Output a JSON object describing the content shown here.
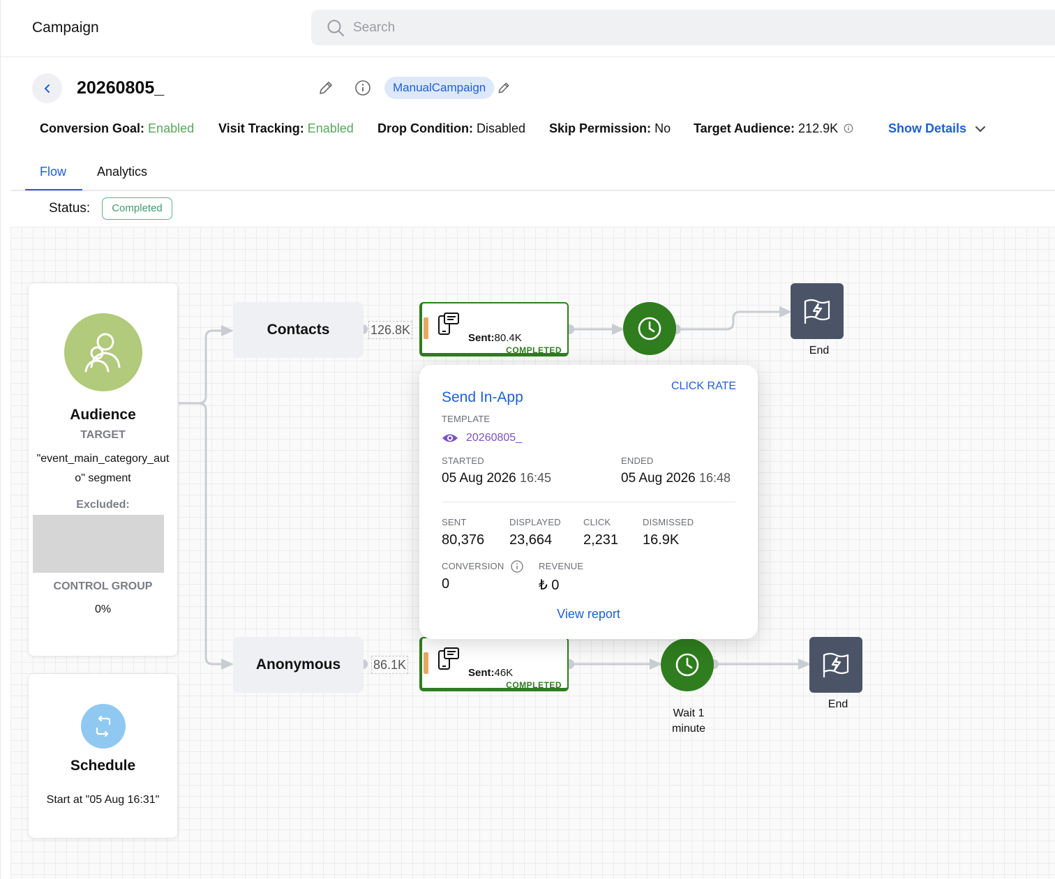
{
  "app": {
    "title": "Campaign",
    "search_placeholder": "Search"
  },
  "header": {
    "campaign_name": "20260805_",
    "tag": "ManualCampaign",
    "meta": [
      {
        "label": "Conversion Goal:",
        "value": "Enabled",
        "color": "#59a65a"
      },
      {
        "label": "Visit Tracking:",
        "value": "Enabled",
        "color": "#59a65a"
      },
      {
        "label": "Drop Condition:",
        "value": "Disabled",
        "color": "#111111"
      },
      {
        "label": "Skip Permission:",
        "value": "No",
        "color": "#111111"
      },
      {
        "label": "Target Audience:",
        "value": "212.9K",
        "color": "#111111"
      }
    ],
    "show_details": "Show Details"
  },
  "tabs": [
    {
      "label": "Flow",
      "active": true
    },
    {
      "label": "Analytics",
      "active": false
    }
  ],
  "status": {
    "label": "Status:",
    "value": "Completed"
  },
  "flow": {
    "audience": {
      "title": "Audience",
      "target_label": "TARGET",
      "segment": "\"event_main_category_auto\" segment",
      "excluded_label": "Excluded:",
      "control_group_label": "CONTROL GROUP",
      "control_group_value": "0%"
    },
    "schedule": {
      "title": "Schedule",
      "start": "Start at \"05 Aug 16:31\""
    },
    "branches": [
      {
        "name": "Contacts",
        "count": "126.8K",
        "sent_label": "Sent:",
        "sent": "80.4K",
        "state": "COMPLETED"
      },
      {
        "name": "Anonymous",
        "count": "86.1K",
        "sent_label": "Sent:",
        "sent": "46K",
        "state": "COMPLETED"
      }
    ],
    "wait_label": "Wait 1 minute",
    "end_label": "End"
  },
  "popup": {
    "click_rate": "CLICK RATE",
    "title": "Send In-App",
    "template_label": "TEMPLATE",
    "template_name": "20260805_",
    "started_label": "STARTED",
    "started_date": "05 Aug 2026",
    "started_time": "16:45",
    "ended_label": "ENDED",
    "ended_date": "05 Aug 2026",
    "ended_time": "16:48",
    "stats": [
      {
        "label": "SENT",
        "value": "80,376"
      },
      {
        "label": "DISPLAYED",
        "value": "23,664"
      },
      {
        "label": "CLICK",
        "value": "2,231"
      },
      {
        "label": "DISMISSED",
        "value": "16.9K"
      }
    ],
    "conversion_label": "CONVERSION",
    "conversion_value": "0",
    "revenue_label": "REVENUE",
    "revenue_value": "₺ 0",
    "view_report": "View report"
  },
  "colors": {
    "accent": "#1f5fd1",
    "success": "#2e7d1f",
    "enabled": "#59a65a",
    "end_node": "#4b5467"
  }
}
